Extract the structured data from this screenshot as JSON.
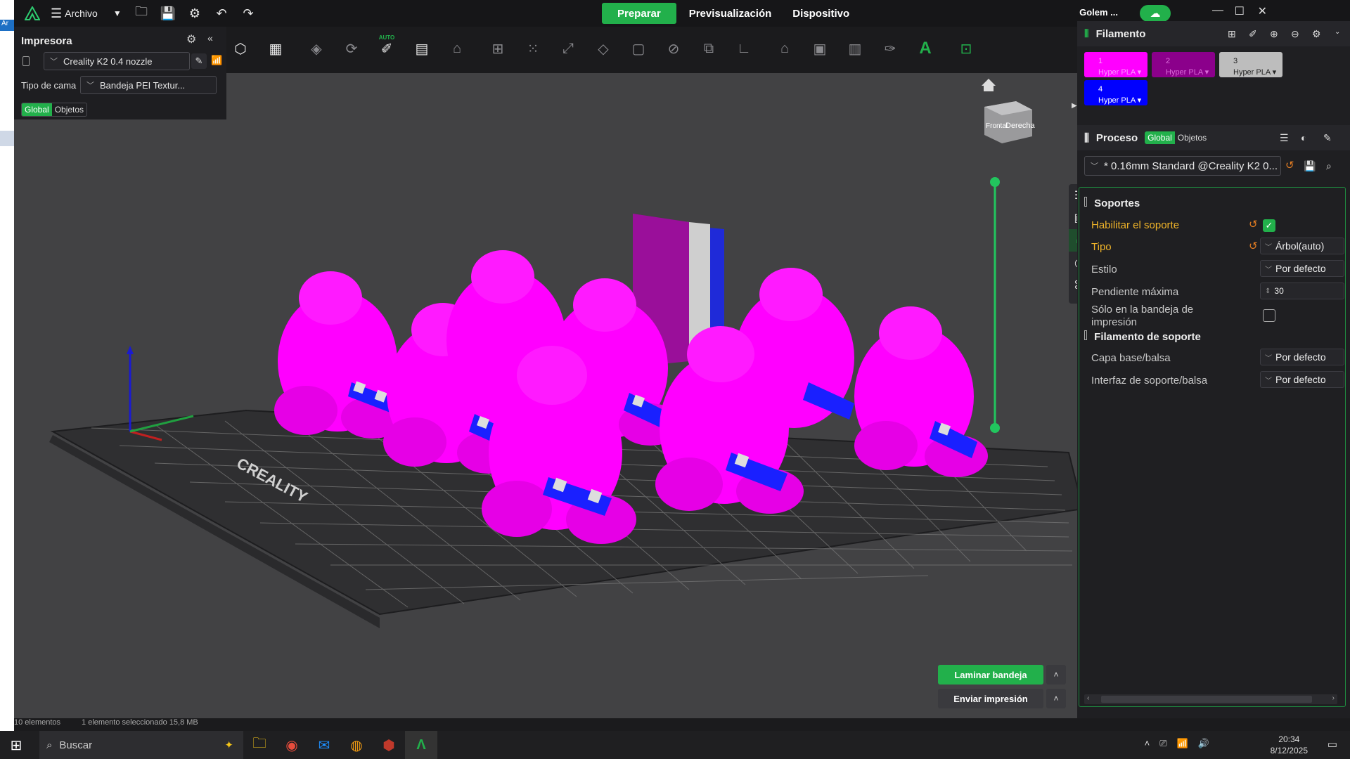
{
  "left_sliver": {
    "label": "Ar"
  },
  "app": {
    "menu_label": "Archivo",
    "nav_tabs": [
      "Preparar",
      "Previsualización",
      "Dispositivo"
    ],
    "active_tab": "Preparar",
    "user": "Golem ...",
    "accent": "#22b04b"
  },
  "printer": {
    "title": "Impresora",
    "model": "Creality K2 0.4 nozzle",
    "bed_label": "Tipo de cama",
    "bed_value": "Bandeja PEI Textur...",
    "scope_global": "Global",
    "scope_objects": "Objetos"
  },
  "toolbar": {
    "icons": [
      "add-object-icon",
      "arrange-grid-icon",
      "orient-icon",
      "rotate-icon",
      "auto-orient-icon",
      "split-icon",
      "cut-icon",
      "layout-icon",
      "array-icon",
      "scale-icon",
      "support-paint-icon",
      "seam-icon",
      "measure-icon",
      "assembly-icon",
      "brim-icon",
      "height-range-icon",
      "mesh-boolean-icon",
      "fill-icon",
      "layer-icon",
      "paint-icon",
      "text-icon",
      "zoom-fit-icon"
    ],
    "auto_badge": "AUTO"
  },
  "view_cube": {
    "front": "Frontal",
    "right": "Derecha"
  },
  "bed": {
    "brand_text": "CREALITY"
  },
  "filament": {
    "title": "Filamento",
    "chips": [
      {
        "num": "1",
        "name": "Hyper PLA",
        "color": "#ff00ff",
        "text": "#ff99ff"
      },
      {
        "num": "2",
        "name": "Hyper PLA",
        "color": "#8b008b",
        "text": "#d96bd9"
      },
      {
        "num": "3",
        "name": "Hyper PLA",
        "color": "#bdbdbd",
        "text": "#222222"
      },
      {
        "num": "4",
        "name": "Hyper PLA",
        "color": "#0000ff",
        "text": "#ffffff"
      }
    ]
  },
  "process": {
    "title": "Proceso",
    "scope_global": "Global",
    "scope_objects": "Objetos",
    "profile": "* 0.16mm Standard @Creality K2 0...",
    "section_supports": "Soportes",
    "enable_support_label": "Habilitar el soporte",
    "type_label": "Tipo",
    "type_value": "Árbol(auto)",
    "style_label": "Estilo",
    "style_value": "Por defecto",
    "max_slope_label": "Pendiente máxima",
    "max_slope_value": "30",
    "bed_only_label": "Sólo en la bandeja de impresión",
    "section_support_filament": "Filamento de soporte",
    "base_label": "Capa base/balsa",
    "base_value": "Por defecto",
    "interface_label": "Interfaz de soporte/balsa",
    "interface_value": "Por defecto"
  },
  "actions": {
    "slice": "Laminar bandeja",
    "send": "Enviar impresión"
  },
  "status": {
    "count": "10 elementos",
    "selected": "1 elemento seleccionado  15,8 MB"
  },
  "taskbar": {
    "search": "Buscar",
    "time": "20:34",
    "date": "8/12/2025"
  }
}
